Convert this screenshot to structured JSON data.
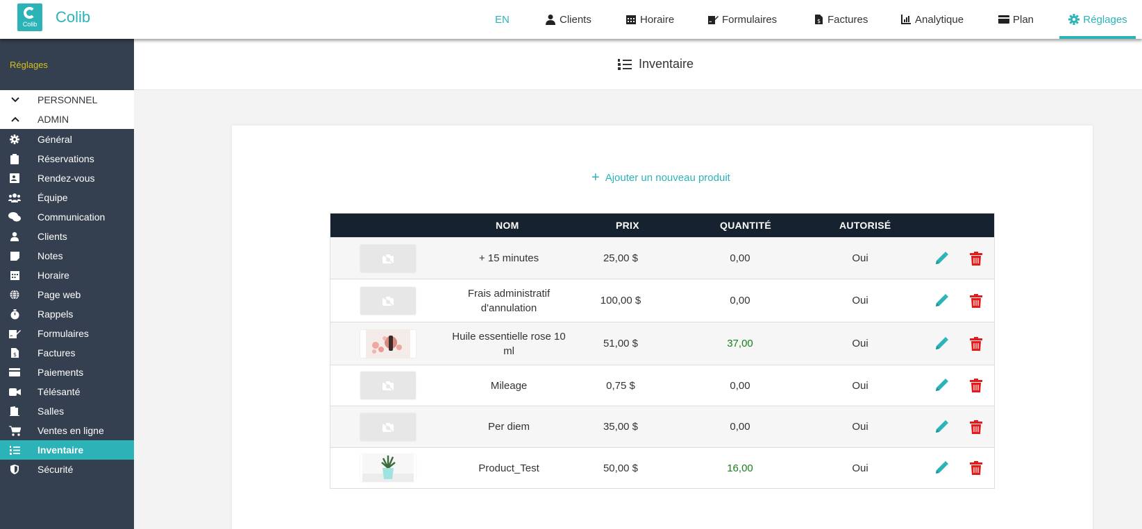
{
  "app": {
    "brand": "Colib",
    "logo_text": "Colib"
  },
  "nav": {
    "lang": "EN",
    "clients": "Clients",
    "horaire": "Horaire",
    "formulaires": "Formulaires",
    "factures": "Factures",
    "analytique": "Analytique",
    "plan": "Plan",
    "reglages": "Réglages"
  },
  "sidebar": {
    "title": "Réglages",
    "groups": [
      {
        "label": "PERSONNEL",
        "expanded": false
      },
      {
        "label": "ADMIN",
        "expanded": true
      }
    ],
    "items": [
      {
        "label": "Général",
        "icon": "gear-icon"
      },
      {
        "label": "Réservations",
        "icon": "clipboard-icon"
      },
      {
        "label": "Rendez-vous",
        "icon": "contact-card-icon"
      },
      {
        "label": "Équipe",
        "icon": "users-icon"
      },
      {
        "label": "Communication",
        "icon": "chat-icon"
      },
      {
        "label": "Clients",
        "icon": "user-icon"
      },
      {
        "label": "Notes",
        "icon": "note-icon"
      },
      {
        "label": "Horaire",
        "icon": "calendar-icon"
      },
      {
        "label": "Page web",
        "icon": "globe-icon"
      },
      {
        "label": "Rappels",
        "icon": "stopwatch-icon"
      },
      {
        "label": "Formulaires",
        "icon": "signature-icon"
      },
      {
        "label": "Factures",
        "icon": "invoice-icon"
      },
      {
        "label": "Paiements",
        "icon": "credit-card-icon"
      },
      {
        "label": "Télésanté",
        "icon": "video-icon"
      },
      {
        "label": "Salles",
        "icon": "door-icon"
      },
      {
        "label": "Ventes en ligne",
        "icon": "cart-icon"
      },
      {
        "label": "Inventaire",
        "icon": "list-ol-icon",
        "active": true
      },
      {
        "label": "Sécurité",
        "icon": "shield-icon"
      }
    ]
  },
  "page": {
    "title": "Inventaire",
    "add_product": "Ajouter un nouveau produit"
  },
  "table": {
    "headers": {
      "nom": "NOM",
      "prix": "PRIX",
      "quantite": "QUANTITÉ",
      "autorise": "AUTORISÉ"
    },
    "rows": [
      {
        "image": "no-photo",
        "nom": "+ 15 minutes",
        "prix": "25,00 $",
        "quantite": "0,00",
        "autorise": "Oui"
      },
      {
        "image": "no-photo",
        "nom": "Frais administratif d'annulation",
        "prix": "100,00 $",
        "quantite": "0,00",
        "autorise": "Oui"
      },
      {
        "image": "rose-oil-photo",
        "nom": "Huile essentielle rose 10 ml",
        "prix": "51,00 $",
        "quantite": "37,00",
        "autorise": "Oui"
      },
      {
        "image": "no-photo",
        "nom": "Mileage",
        "prix": "0,75 $",
        "quantite": "0,00",
        "autorise": "Oui"
      },
      {
        "image": "no-photo",
        "nom": "Per diem",
        "prix": "35,00 $",
        "quantite": "0,00",
        "autorise": "Oui"
      },
      {
        "image": "plant-photo",
        "nom": "Product_Test",
        "prix": "50,00 $",
        "quantite": "16,00",
        "autorise": "Oui"
      }
    ]
  },
  "colors": {
    "accent": "#2bb3b8",
    "sidebar_bg": "#343f4f",
    "table_header": "#162230",
    "delete": "#e41b1b",
    "positive_qty": "#1a7f1a",
    "sidebar_title": "#d6c21c"
  }
}
